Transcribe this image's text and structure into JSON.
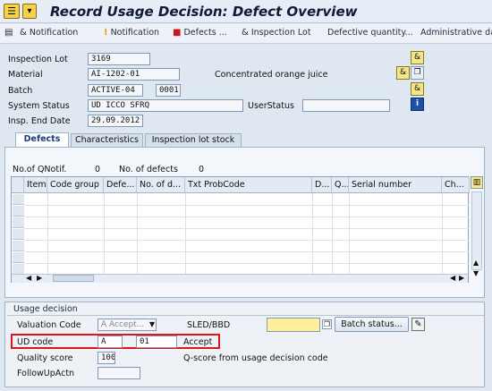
{
  "window": {
    "title": "Record Usage Decision: Defect Overview"
  },
  "toolbar": {
    "items": [
      {
        "label": "Notification",
        "icon": "&"
      },
      {
        "label": "Notification",
        "icon": "!"
      },
      {
        "label": "Defects ...",
        "icon": "■"
      },
      {
        "label": "Inspection Lot",
        "icon": "&"
      },
      {
        "label": "Defective quantity..."
      },
      {
        "label": "Administrative data"
      }
    ]
  },
  "header": {
    "inspection_lot_label": "Inspection Lot",
    "inspection_lot_value": "3169",
    "material_label": "Material",
    "material_value": "AI-1202-01",
    "material_desc": "Concentrated orange juice",
    "batch_label": "Batch",
    "batch_value": "ACTIVE-04",
    "batch_extra": "0001",
    "system_status_label": "System Status",
    "system_status_value": "UD   ICCO SFRQ",
    "user_status_label": "UserStatus",
    "user_status_value": "",
    "insp_end_label": "Insp. End Date",
    "insp_end_value": "29.09.2012"
  },
  "tabs": [
    "Defects",
    "Characteristics",
    "Inspection lot stock"
  ],
  "defects": {
    "qnotif_label": "No.of QNotif.",
    "qnotif_value": "0",
    "defects_label": "No. of defects",
    "defects_value": "0",
    "columns": [
      "Item",
      "Code group",
      "Defe...",
      "No. of d...",
      "Txt ProbCode",
      "D...",
      "Q...",
      "Serial number",
      "Ch..."
    ]
  },
  "usage_decision": {
    "section_title": "Usage decision",
    "valuation_label": "Valuation Code",
    "valuation_value": "A Accept...",
    "sled_label": "SLED/BBD",
    "sled_value": "",
    "batch_status_button": "Batch status...",
    "ud_code_label": "UD code",
    "ud_code_value": "A",
    "ud_code_num": "01",
    "ud_code_text": "Accept",
    "quality_label": "Quality score",
    "quality_value": "100",
    "quality_desc": "Q-score from usage decision code",
    "followup_label": "FollowUpActn",
    "followup_value": ""
  },
  "colors": {
    "highlight": "#e0141b",
    "sled_field": "#ffef9b",
    "active_tab_text": "#1b3b7a"
  }
}
